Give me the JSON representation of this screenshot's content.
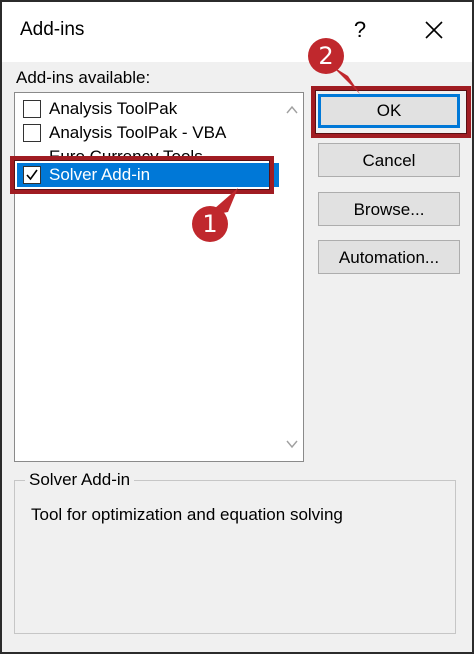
{
  "dialog": {
    "title": "Add-ins",
    "help_label": "?"
  },
  "addins": {
    "label": "Add-ins available:",
    "items": [
      {
        "label": "Analysis ToolPak",
        "checked": false
      },
      {
        "label": "Analysis ToolPak - VBA",
        "checked": false
      },
      {
        "label": "Euro Currency Tools",
        "checked": false
      },
      {
        "label": "Solver Add-in",
        "checked": true,
        "selected": true
      }
    ]
  },
  "buttons": {
    "ok": "OK",
    "cancel": "Cancel",
    "browse": "Browse...",
    "automation": "Automation..."
  },
  "description": {
    "title": "Solver Add-in",
    "text": "Tool for optimization and equation solving"
  },
  "annotations": {
    "step1": "1",
    "step2": "2",
    "color": "#c0282d"
  },
  "colors": {
    "selection": "#0078d7",
    "highlight_box": "#a01c22",
    "dialog_bg": "#f0f0f0"
  }
}
